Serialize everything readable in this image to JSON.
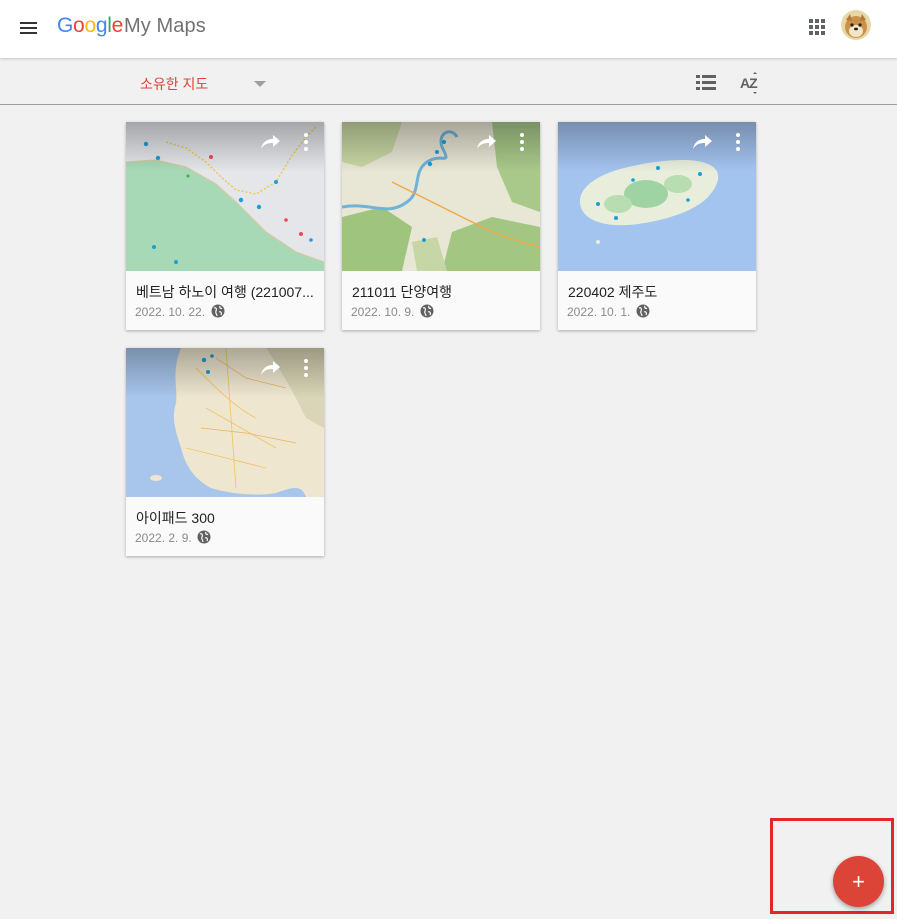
{
  "header": {
    "logo_letters": [
      "G",
      "o",
      "o",
      "g",
      "l",
      "e"
    ],
    "logo_colors": [
      "#4285f4",
      "#ea4335",
      "#fbbc05",
      "#4285f4",
      "#34a853",
      "#ea4335"
    ],
    "app_name": "My Maps",
    "menu_icon": "hamburger-menu-icon",
    "apps_icon": "google-apps-grid-icon",
    "avatar": "user-avatar"
  },
  "toolbar": {
    "owner_filter": "소유한 지도",
    "view_icon": "list-view-icon",
    "sort_icon": "sort-az-icon",
    "sort_label": "AZ"
  },
  "maps": [
    {
      "title": "베트남 하노이 여행 (221007...",
      "date": "2022. 10. 22.",
      "thumbnail": "vietnam-coast-map"
    },
    {
      "title": "211011 단양여행",
      "date": "2022. 10. 9.",
      "thumbnail": "danyang-terrain-map"
    },
    {
      "title": "220402 제주도",
      "date": "2022. 10. 1.",
      "thumbnail": "jeju-island-map"
    },
    {
      "title": "아이패드 300",
      "date": "2022. 2. 9.",
      "thumbnail": "korea-peninsula-map"
    }
  ],
  "fab": {
    "label": "+",
    "icon": "create-map-plus-icon"
  },
  "colors": {
    "accent": "#db4437",
    "background": "#f1f1f1",
    "card": "#fafafa"
  }
}
